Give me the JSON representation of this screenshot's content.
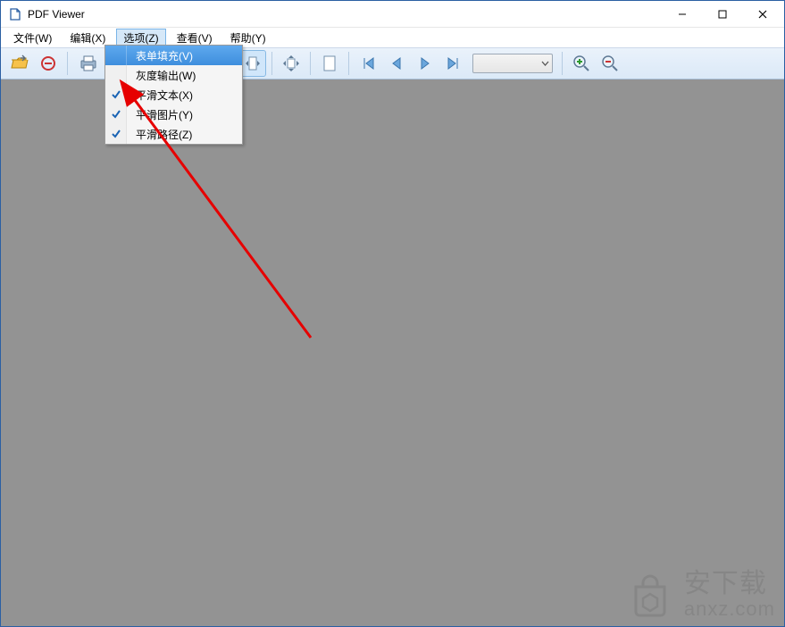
{
  "window": {
    "title": "PDF Viewer"
  },
  "menubar": {
    "file": "文件(W)",
    "edit": "编辑(X)",
    "options": "选项(Z)",
    "view": "查看(V)",
    "help": "帮助(Y)"
  },
  "dropdown": {
    "items": [
      {
        "label": "表单填充(V)",
        "checked": false,
        "highlight": true
      },
      {
        "label": "灰度输出(W)",
        "checked": false,
        "highlight": false
      },
      {
        "label": "平滑文本(X)",
        "checked": true,
        "highlight": false
      },
      {
        "label": "平滑图片(Y)",
        "checked": true,
        "highlight": false
      },
      {
        "label": "平滑路径(Z)",
        "checked": true,
        "highlight": false
      }
    ]
  },
  "toolbar": {
    "open": "open-icon",
    "remove": "minus-circle-icon",
    "print": "printer-icon",
    "view_single": "page-single-icon",
    "view_cont": "page-continuous-icon",
    "view_2up": "page-two-up-icon",
    "fit_width": "fit-width-icon",
    "fit_page": "fit-page-icon",
    "blank_page": "blank-page-icon",
    "nav_first": "nav-first-icon",
    "nav_prev": "nav-prev-icon",
    "nav_next": "nav-next-icon",
    "nav_last": "nav-last-icon",
    "page_combo": "",
    "zoom_in": "zoom-in-icon",
    "zoom_out": "zoom-out-icon"
  },
  "watermark": {
    "cn": "安下载",
    "en": "anxz.com"
  },
  "colors": {
    "accent": "#3e8edd",
    "toolbar_grad_top": "#eaf2fb",
    "toolbar_grad_bottom": "#dbe9f7",
    "workspace": "#939393"
  }
}
